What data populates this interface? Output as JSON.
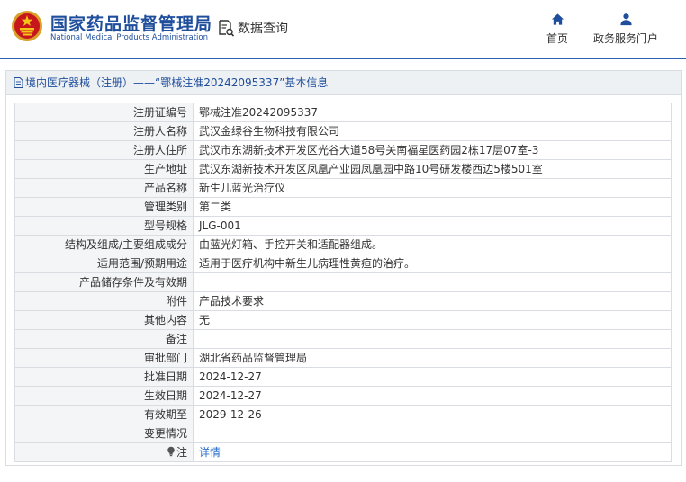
{
  "header": {
    "org_name_cn": "国家药品监督管理局",
    "org_name_en": "National Medical Products Administration",
    "query_label": "数据查询",
    "nav": {
      "home": "首页",
      "gov_portal": "政务服务门户"
    },
    "icons": {
      "emblem": "national-emblem-icon",
      "query": "document-search-icon",
      "home": "home-icon",
      "gov": "user-icon"
    },
    "colors": {
      "brand": "#1f4e9c",
      "accent_line": "#2a63b5",
      "link": "#2a6fcc"
    }
  },
  "panel": {
    "title": "境内医疗器械（注册）——“鄂械注准20242095337”基本信息"
  },
  "rows": [
    {
      "label": "注册证编号",
      "value": "鄂械注准20242095337"
    },
    {
      "label": "注册人名称",
      "value": "武汉金绿谷生物科技有限公司"
    },
    {
      "label": "注册人住所",
      "value": "武汉市东湖新技术开发区光谷大道58号关南福星医药园2栋17层07室-3"
    },
    {
      "label": "生产地址",
      "value": "武汉东湖新技术开发区凤凰产业园凤凰园中路10号研发楼西边5楼501室"
    },
    {
      "label": "产品名称",
      "value": "新生儿蓝光治疗仪"
    },
    {
      "label": "管理类别",
      "value": "第二类"
    },
    {
      "label": "型号规格",
      "value": "JLG-001"
    },
    {
      "label": "结构及组成/主要组成成分",
      "value": "由蓝光灯箱、手控开关和适配器组成。"
    },
    {
      "label": "适用范围/预期用途",
      "value": "适用于医疗机构中新生儿病理性黄疸的治疗。"
    },
    {
      "label": "产品储存条件及有效期",
      "value": ""
    },
    {
      "label": "附件",
      "value": "产品技术要求"
    },
    {
      "label": "其他内容",
      "value": "无"
    },
    {
      "label": "备注",
      "value": ""
    },
    {
      "label": "审批部门",
      "value": "湖北省药品监督管理局"
    },
    {
      "label": "批准日期",
      "value": "2024-12-27"
    },
    {
      "label": "生效日期",
      "value": "2024-12-27"
    },
    {
      "label": "有效期至",
      "value": "2029-12-26"
    },
    {
      "label": "变更情况",
      "value": ""
    }
  ],
  "note_row": {
    "label": "注",
    "link": "详情",
    "icon": "lightbulb-icon"
  }
}
